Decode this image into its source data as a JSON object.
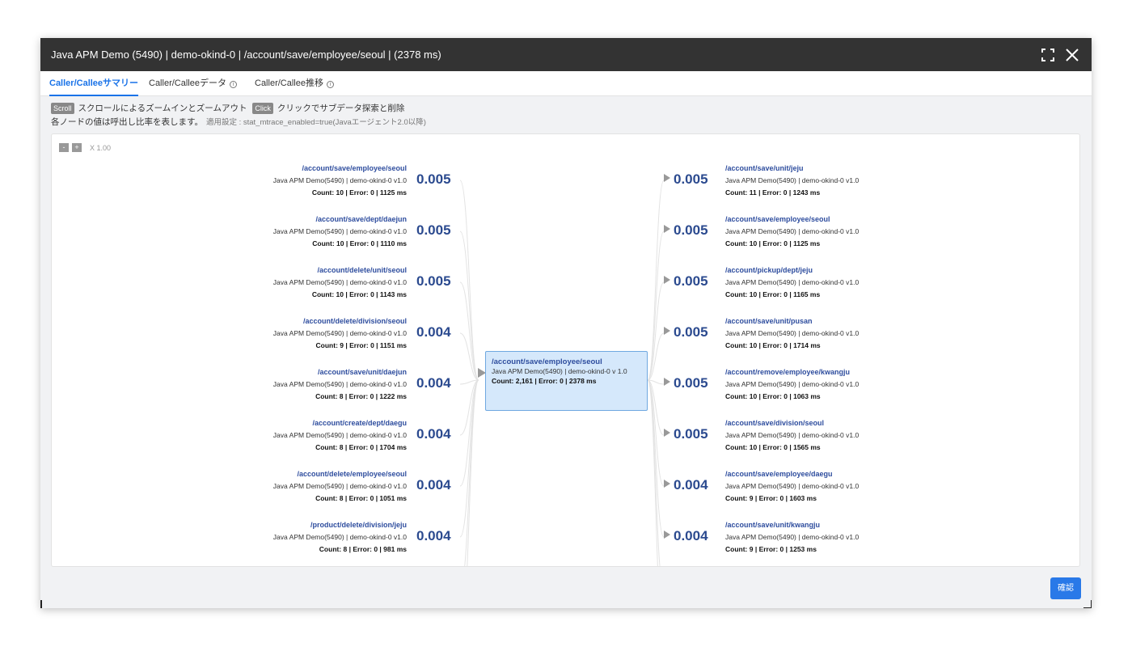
{
  "window": {
    "title": "Java APM Demo (5490) | demo-okind-0 | /account/save/employee/seoul | (2378 ms)",
    "icons": [
      "fullscreen-icon",
      "close-icon"
    ]
  },
  "tabs": [
    {
      "label": "Caller/Calleeサマリー",
      "active": true
    },
    {
      "label": "Caller/Calleeデータ",
      "active": false
    },
    {
      "label": "Caller/Callee推移",
      "active": false
    }
  ],
  "hints": {
    "scroll_key": "Scroll",
    "scroll_text": "スクロールによるズームインとズームアウト",
    "click_key": "Click",
    "click_text": "クリックでサブデータ探索と削除",
    "ratio_text": "各ノードの値は呼出し比率を表します。",
    "setting_text": "適用設定 : stat_mtrace_enabled=true(Javaエージェント2.0以降)"
  },
  "zoom": {
    "minus": "-",
    "plus": "+",
    "level": "X 1.00"
  },
  "center_node": {
    "path": "/account/save/employee/seoul",
    "app": "Java APM Demo(5490) | demo-okind-0 v 1.0",
    "stats": "Count: 2,161 | Error: 0 | 2378 ms"
  },
  "callers": [
    {
      "path": "/account/save/employee/seoul",
      "app": "Java APM Demo(5490) | demo-okind-0 v1.0",
      "stats": "Count: 10 | Error: 0 | 1125 ms",
      "ratio": "0.005"
    },
    {
      "path": "/account/save/dept/daejun",
      "app": "Java APM Demo(5490) | demo-okind-0 v1.0",
      "stats": "Count: 10 | Error: 0 | 1110 ms",
      "ratio": "0.005"
    },
    {
      "path": "/account/delete/unit/seoul",
      "app": "Java APM Demo(5490) | demo-okind-0 v1.0",
      "stats": "Count: 10 | Error: 0 | 1143 ms",
      "ratio": "0.005"
    },
    {
      "path": "/account/delete/division/seoul",
      "app": "Java APM Demo(5490) | demo-okind-0 v1.0",
      "stats": "Count: 9 | Error: 0 | 1151 ms",
      "ratio": "0.004"
    },
    {
      "path": "/account/save/unit/daejun",
      "app": "Java APM Demo(5490) | demo-okind-0 v1.0",
      "stats": "Count: 8 | Error: 0 | 1222 ms",
      "ratio": "0.004"
    },
    {
      "path": "/account/create/dept/daegu",
      "app": "Java APM Demo(5490) | demo-okind-0 v1.0",
      "stats": "Count: 8 | Error: 0 | 1704 ms",
      "ratio": "0.004"
    },
    {
      "path": "/account/delete/employee/seoul",
      "app": "Java APM Demo(5490) | demo-okind-0 v1.0",
      "stats": "Count: 8 | Error: 0 | 1051 ms",
      "ratio": "0.004"
    },
    {
      "path": "/product/delete/division/jeju",
      "app": "Java APM Demo(5490) | demo-okind-0 v1.0",
      "stats": "Count: 8 | Error: 0 | 981 ms",
      "ratio": "0.004"
    }
  ],
  "callees": [
    {
      "path": "/account/save/unit/jeju",
      "app": "Java APM Demo(5490) | demo-okind-0 v1.0",
      "stats": "Count: 11 | Error: 0 | 1243 ms",
      "ratio": "0.005"
    },
    {
      "path": "/account/save/employee/seoul",
      "app": "Java APM Demo(5490) | demo-okind-0 v1.0",
      "stats": "Count: 10 | Error: 0 | 1125 ms",
      "ratio": "0.005"
    },
    {
      "path": "/account/pickup/dept/jeju",
      "app": "Java APM Demo(5490) | demo-okind-0 v1.0",
      "stats": "Count: 10 | Error: 0 | 1165 ms",
      "ratio": "0.005"
    },
    {
      "path": "/account/save/unit/pusan",
      "app": "Java APM Demo(5490) | demo-okind-0 v1.0",
      "stats": "Count: 10 | Error: 0 | 1714 ms",
      "ratio": "0.005"
    },
    {
      "path": "/account/remove/employee/kwangju",
      "app": "Java APM Demo(5490) | demo-okind-0 v1.0",
      "stats": "Count: 10 | Error: 0 | 1063 ms",
      "ratio": "0.005"
    },
    {
      "path": "/account/save/division/seoul",
      "app": "Java APM Demo(5490) | demo-okind-0 v1.0",
      "stats": "Count: 10 | Error: 0 | 1565 ms",
      "ratio": "0.005"
    },
    {
      "path": "/account/save/employee/daegu",
      "app": "Java APM Demo(5490) | demo-okind-0 v1.0",
      "stats": "Count: 9 | Error: 0 | 1603 ms",
      "ratio": "0.004"
    },
    {
      "path": "/account/save/unit/kwangju",
      "app": "Java APM Demo(5490) | demo-okind-0 v1.0",
      "stats": "Count: 9 | Error: 0 | 1253 ms",
      "ratio": "0.004"
    }
  ],
  "footer": {
    "confirm_label": "確認"
  }
}
